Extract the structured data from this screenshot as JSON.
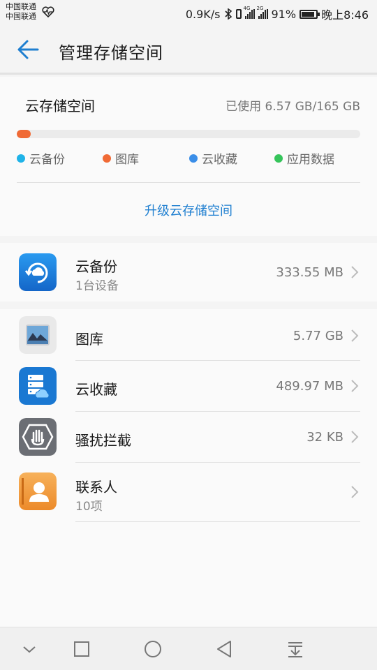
{
  "status_bar": {
    "carrier_1": "中国联通",
    "carrier_2": "中国联通",
    "speed": "0.9K/s",
    "net_1": "4G",
    "net_2": "2G",
    "battery": "91%",
    "battery_level": 0.91,
    "time": "晚上8:46"
  },
  "header": {
    "title": "管理存储空间",
    "back_icon": "back-arrow-icon"
  },
  "storage": {
    "label": "云存储空间",
    "used_text": "已使用 6.57 GB/165 GB",
    "used_fraction": 0.04,
    "legend": [
      {
        "label": "云备份",
        "color": "#1fb3e8"
      },
      {
        "label": "图库",
        "color": "#f06a35"
      },
      {
        "label": "云收藏",
        "color": "#3a8ee8"
      },
      {
        "label": "应用数据",
        "color": "#35c45a"
      }
    ],
    "upgrade": "升级云存储空间"
  },
  "backup": {
    "title": "云备份",
    "subtitle": "1台设备",
    "value": "333.55 MB",
    "icon": "cloud-backup-icon"
  },
  "items": [
    {
      "title": "图库",
      "value": "5.77 GB",
      "icon": "gallery-icon"
    },
    {
      "title": "云收藏",
      "value": "489.97 MB",
      "icon": "cloud-favorites-icon"
    },
    {
      "title": "骚扰拦截",
      "value": "32 KB",
      "icon": "harassment-block-icon"
    },
    {
      "title": "联系人",
      "subtitle": "10项",
      "value": "",
      "icon": "contacts-icon"
    }
  ],
  "nav": [
    "collapse-icon",
    "recents-icon",
    "home-icon",
    "back-icon",
    "notification-icon"
  ],
  "colors": {
    "accent": "#1f7fd0",
    "storage_fill": "#f06a35"
  }
}
